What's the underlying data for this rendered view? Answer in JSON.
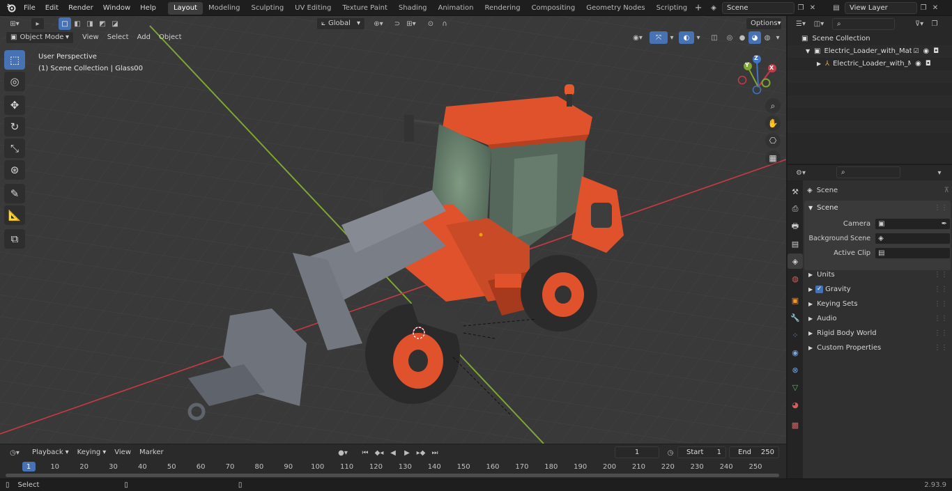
{
  "menu": [
    "File",
    "Edit",
    "Render",
    "Window",
    "Help"
  ],
  "workspaces": [
    "Layout",
    "Modeling",
    "Sculpting",
    "UV Editing",
    "Texture Paint",
    "Shading",
    "Animation",
    "Rendering",
    "Compositing",
    "Geometry Nodes",
    "Scripting"
  ],
  "active_workspace": "Layout",
  "scene_name": "Scene",
  "view_layer": "View Layer",
  "viewport": {
    "mode": "Object Mode",
    "menus": [
      "View",
      "Select",
      "Add",
      "Object"
    ],
    "orientation": "Global",
    "options_label": "Options",
    "perspective_label": "User Perspective",
    "collection_label": "(1) Scene Collection | Glass00",
    "gizmo_axes": [
      "X",
      "Y",
      "Z"
    ]
  },
  "outliner": {
    "root": "Scene Collection",
    "items": [
      {
        "label": "Electric_Loader_with_Material",
        "depth": 1
      },
      {
        "label": "Electric_Loader_with_Mat",
        "depth": 2
      }
    ]
  },
  "properties": {
    "header": "Scene",
    "panel_title": "Scene",
    "fields": [
      {
        "label": "Camera",
        "value": ""
      },
      {
        "label": "Background Scene",
        "value": ""
      },
      {
        "label": "Active Clip",
        "value": ""
      }
    ],
    "subpanels": [
      "Units",
      "Gravity",
      "Keying Sets",
      "Audio",
      "Rigid Body World",
      "Custom Properties"
    ]
  },
  "timeline": {
    "menus": [
      "Playback",
      "Keying",
      "View",
      "Marker"
    ],
    "current_frame": "1",
    "start_label": "Start",
    "start": "1",
    "end_label": "End",
    "end": "250",
    "ticks": [
      "1",
      "10",
      "20",
      "30",
      "40",
      "50",
      "60",
      "70",
      "80",
      "90",
      "100",
      "110",
      "120",
      "130",
      "140",
      "150",
      "160",
      "170",
      "180",
      "190",
      "200",
      "210",
      "220",
      "230",
      "240",
      "250"
    ]
  },
  "status": {
    "left": "Select",
    "version": "2.93.9"
  },
  "colors": {
    "accent": "#4772b3",
    "loader_body": "#e0522c",
    "x_axis": "#c83a45",
    "y_axis": "#7fa534",
    "z_axis": "#3f75c9"
  }
}
